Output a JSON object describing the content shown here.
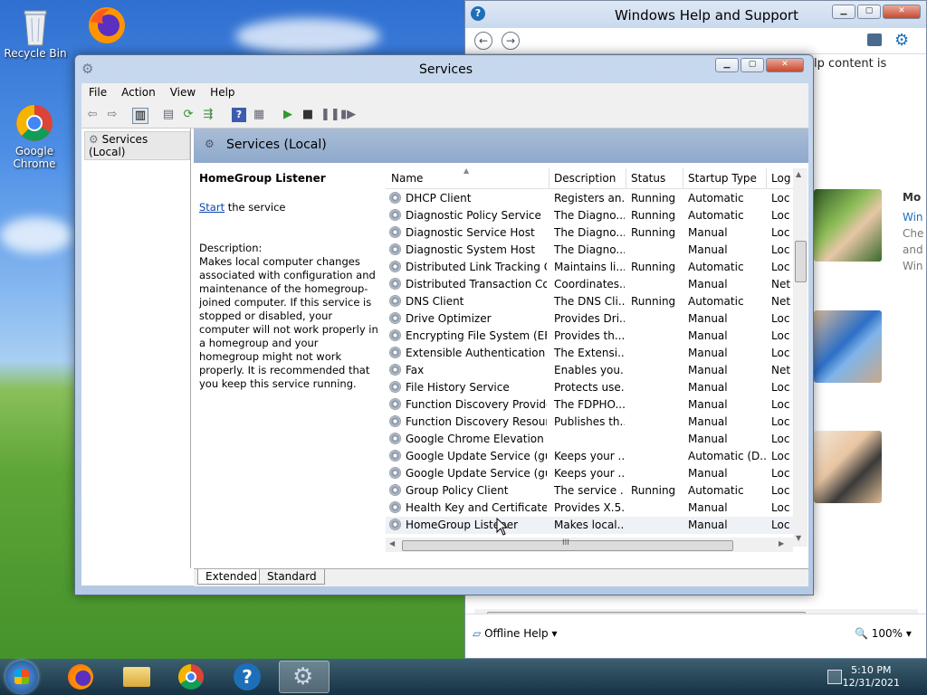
{
  "desktop": {
    "icons": [
      {
        "label": "Recycle Bin"
      },
      {
        "label": "Google Chrome"
      }
    ]
  },
  "help_window": {
    "title": "Windows Help and Support",
    "partial_text": "lp content is",
    "side_heading": "Mo",
    "side_lines": [
      "Win",
      "Che",
      "and",
      "Win"
    ],
    "status": {
      "offline_label": "Offline Help",
      "zoom": "100%"
    }
  },
  "services_window": {
    "title": "Services",
    "menu": [
      "File",
      "Action",
      "View",
      "Help"
    ],
    "tree_node": "Services (Local)",
    "pane_header": "Services (Local)",
    "description_panel": {
      "service_name": "HomeGroup Listener",
      "start_link": "Start",
      "start_suffix": " the service",
      "description_label": "Description:",
      "description_text": "Makes local computer changes associated with configuration and maintenance of the homegroup-joined computer. If this service is stopped or disabled, your computer will not work properly in a homegroup and your homegroup might not work properly. It is recommended that you keep this service running."
    },
    "columns": [
      "Name",
      "Description",
      "Status",
      "Startup Type",
      "Log"
    ],
    "rows": [
      {
        "name": "DHCP Client",
        "description": "Registers an...",
        "status": "Running",
        "startup": "Automatic",
        "log": "Loc"
      },
      {
        "name": "Diagnostic Policy Service",
        "description": "The Diagno...",
        "status": "Running",
        "startup": "Automatic",
        "log": "Loc"
      },
      {
        "name": "Diagnostic Service Host",
        "description": "The Diagno...",
        "status": "Running",
        "startup": "Manual",
        "log": "Loc"
      },
      {
        "name": "Diagnostic System Host",
        "description": "The Diagno...",
        "status": "",
        "startup": "Manual",
        "log": "Loc"
      },
      {
        "name": "Distributed Link Tracking Cl...",
        "description": "Maintains li...",
        "status": "Running",
        "startup": "Automatic",
        "log": "Loc"
      },
      {
        "name": "Distributed Transaction Co...",
        "description": "Coordinates...",
        "status": "",
        "startup": "Manual",
        "log": "Net"
      },
      {
        "name": "DNS Client",
        "description": "The DNS Cli...",
        "status": "Running",
        "startup": "Automatic",
        "log": "Net"
      },
      {
        "name": "Drive Optimizer",
        "description": "Provides Dri...",
        "status": "",
        "startup": "Manual",
        "log": "Loc"
      },
      {
        "name": "Encrypting File System (EFS)",
        "description": "Provides th...",
        "status": "",
        "startup": "Manual",
        "log": "Loc"
      },
      {
        "name": "Extensible Authentication P...",
        "description": "The Extensi...",
        "status": "",
        "startup": "Manual",
        "log": "Loc"
      },
      {
        "name": "Fax",
        "description": "Enables you...",
        "status": "",
        "startup": "Manual",
        "log": "Net"
      },
      {
        "name": "File History Service",
        "description": "Protects use...",
        "status": "",
        "startup": "Manual",
        "log": "Loc"
      },
      {
        "name": "Function Discovery Provide...",
        "description": "The FDPHO...",
        "status": "",
        "startup": "Manual",
        "log": "Loc"
      },
      {
        "name": "Function Discovery Resourc...",
        "description": "Publishes th...",
        "status": "",
        "startup": "Manual",
        "log": "Loc"
      },
      {
        "name": "Google Chrome Elevation S...",
        "description": "",
        "status": "",
        "startup": "Manual",
        "log": "Loc"
      },
      {
        "name": "Google Update Service (gup...",
        "description": "Keeps your ...",
        "status": "",
        "startup": "Automatic (D...",
        "log": "Loc"
      },
      {
        "name": "Google Update Service (gup...",
        "description": "Keeps your ...",
        "status": "",
        "startup": "Manual",
        "log": "Loc"
      },
      {
        "name": "Group Policy Client",
        "description": "The service ...",
        "status": "Running",
        "startup": "Automatic",
        "log": "Loc"
      },
      {
        "name": "Health Key and Certificate ...",
        "description": "Provides X.5...",
        "status": "",
        "startup": "Manual",
        "log": "Loc"
      },
      {
        "name": "HomeGroup Listener",
        "description": "Makes local...",
        "status": "",
        "startup": "Manual",
        "log": "Loc"
      }
    ],
    "selected_row": 19,
    "tabs": [
      "Extended",
      "Standard"
    ],
    "hscroll_mark": "III"
  },
  "taskbar": {
    "clock_time": "5:10 PM",
    "clock_date": "12/31/2021",
    "items": [
      "start",
      "firefox",
      "file-explorer",
      "chrome",
      "help",
      "services"
    ]
  }
}
